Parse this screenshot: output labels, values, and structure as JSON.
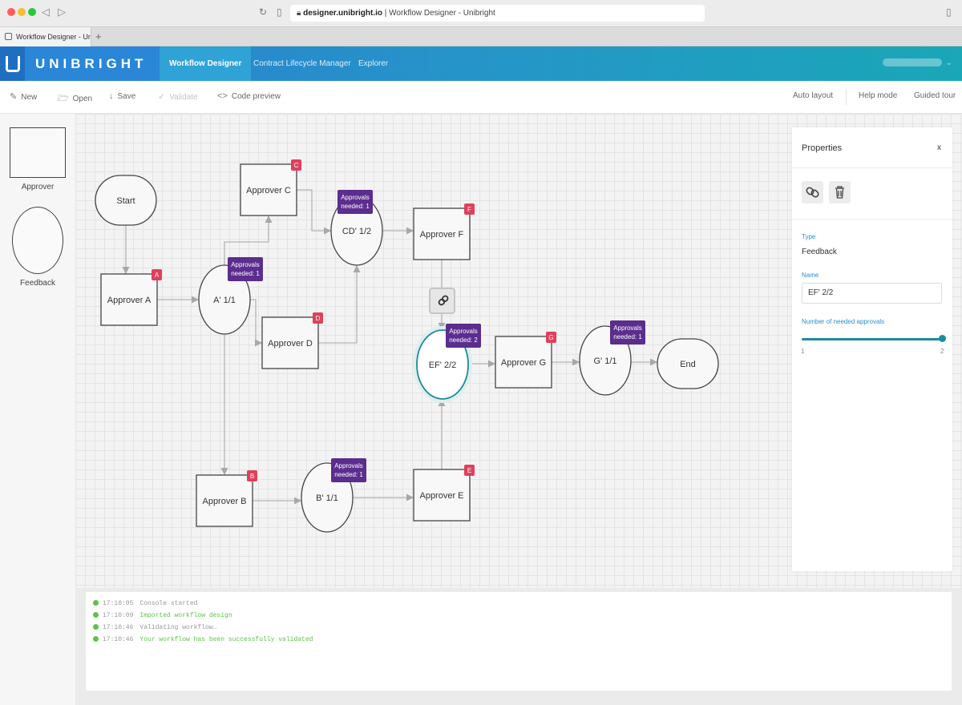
{
  "browser": {
    "url_domain": "designer.unibright.io",
    "url_title": " | Workflow Designer - Unibright",
    "tab_title": "Workflow Designer - Unib",
    "new_tab": "+"
  },
  "app": {
    "brand": "UNIBRIGHT",
    "tabs": [
      {
        "label": "Workflow Designer",
        "active": true
      },
      {
        "label": "Contract Lifecycle Manager",
        "active": false
      },
      {
        "label": "Explorer",
        "active": false
      }
    ],
    "user_chevron": "⌄"
  },
  "toolbar": {
    "new_label": "New",
    "open_label": "Open",
    "save_label": "Save",
    "validate_label": "Validate",
    "code_preview_label": "Code preview",
    "auto_layout_label": "Auto layout",
    "help_mode_label": "Help mode",
    "guided_tour_label": "Guided tour"
  },
  "palette": {
    "approver_label": "Approver",
    "feedback_label": "Feedback"
  },
  "diagram": {
    "nodes": [
      {
        "id": "start",
        "shape": "pill",
        "label": "Start"
      },
      {
        "id": "approverA",
        "shape": "rect",
        "label": "Approver A",
        "badge": "A"
      },
      {
        "id": "a11",
        "shape": "ellipse",
        "label": "A' 1/1",
        "approvals": "Approvals needed: 1"
      },
      {
        "id": "approverC",
        "shape": "rect",
        "label": "Approver C",
        "badge": "C"
      },
      {
        "id": "approverD",
        "shape": "rect",
        "label": "Approver D",
        "badge": "D"
      },
      {
        "id": "cd12",
        "shape": "ellipse",
        "label": "CD' 1/2",
        "approvals": "Approvals needed: 1"
      },
      {
        "id": "approverF",
        "shape": "rect",
        "label": "Approver F",
        "badge": "F"
      },
      {
        "id": "ef22",
        "shape": "ellipse",
        "label": "EF' 2/2",
        "approvals": "Approvals needed: 2",
        "selected": true
      },
      {
        "id": "approverG",
        "shape": "rect",
        "label": "Approver G",
        "badge": "G"
      },
      {
        "id": "g11",
        "shape": "ellipse",
        "label": "G' 1/1",
        "approvals": "Approvals needed: 1"
      },
      {
        "id": "end",
        "shape": "pill",
        "label": "End"
      },
      {
        "id": "approverB",
        "shape": "rect",
        "label": "Approver B",
        "badge": "B"
      },
      {
        "id": "b11",
        "shape": "ellipse",
        "label": "B' 1/1",
        "approvals": "Approvals needed: 1"
      },
      {
        "id": "approverE",
        "shape": "rect",
        "label": "Approver E",
        "badge": "E"
      }
    ],
    "edges": [
      [
        "start",
        "approverA"
      ],
      [
        "approverA",
        "a11"
      ],
      [
        "a11",
        "approverC"
      ],
      [
        "a11",
        "approverD"
      ],
      [
        "a11",
        "approverB"
      ],
      [
        "approverC",
        "cd12"
      ],
      [
        "approverD",
        "cd12"
      ],
      [
        "cd12",
        "approverF"
      ],
      [
        "approverF",
        "ef22"
      ],
      [
        "approverE",
        "ef22"
      ],
      [
        "ef22",
        "approverG"
      ],
      [
        "approverG",
        "g11"
      ],
      [
        "g11",
        "end"
      ],
      [
        "approverB",
        "b11"
      ],
      [
        "b11",
        "approverE"
      ]
    ],
    "link_icon": "link-icon"
  },
  "properties": {
    "title": "Properties",
    "close": "x",
    "type_label": "Type",
    "type_value": "Feedback",
    "name_label": "Name",
    "name_value": "EF' 2/2",
    "approvals_label": "Number of needed approvals",
    "slider_min": "1",
    "slider_max": "2",
    "slider_value": 2
  },
  "console": {
    "lines": [
      {
        "time": "17:10:05",
        "message": "Console started",
        "ok": false
      },
      {
        "time": "17:10:09",
        "message": "Imported workflow design",
        "ok": true
      },
      {
        "time": "17:10:46",
        "message": "Validating workflow…",
        "ok": false
      },
      {
        "time": "17:10:46",
        "message": "Your workflow has been successfully validated",
        "ok": true
      }
    ]
  },
  "colors": {
    "header_start": "#2a7fd0",
    "header_end": "#1aa7b8",
    "badge_red": "#e0405c",
    "approvals_purple": "#5b2d8e",
    "selected_teal": "#1d8b9c",
    "console_green": "#5fc24a"
  }
}
